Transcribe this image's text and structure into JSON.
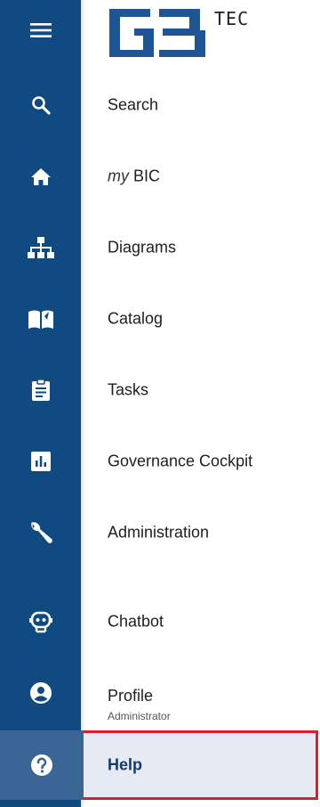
{
  "brand": {
    "tec_text": "TEC"
  },
  "nav": {
    "items": [
      {
        "prefix": "",
        "label": "Search",
        "icon": "search-icon"
      },
      {
        "prefix": "my",
        "label": "BIC",
        "icon": "home-icon"
      },
      {
        "prefix": "",
        "label": "Diagrams",
        "icon": "sitemap-icon"
      },
      {
        "prefix": "",
        "label": "Catalog",
        "icon": "book-icon"
      },
      {
        "prefix": "",
        "label": "Tasks",
        "icon": "clipboard-icon"
      },
      {
        "prefix": "",
        "label": "Governance Cockpit",
        "icon": "chart-icon"
      },
      {
        "prefix": "",
        "label": "Administration",
        "icon": "wrench-icon"
      },
      {
        "prefix": "",
        "label": "Chatbot",
        "icon": "robot-icon"
      }
    ],
    "profile": {
      "label": "Profile",
      "subtitle": "Administrator",
      "icon": "user-icon"
    },
    "help": {
      "label": "Help",
      "icon": "help-icon"
    }
  },
  "colors": {
    "rail": "#114a80",
    "active_icon_bg": "#3a6594",
    "highlight_border": "#d7202f",
    "active_row_bg": "#e6ebf3"
  }
}
